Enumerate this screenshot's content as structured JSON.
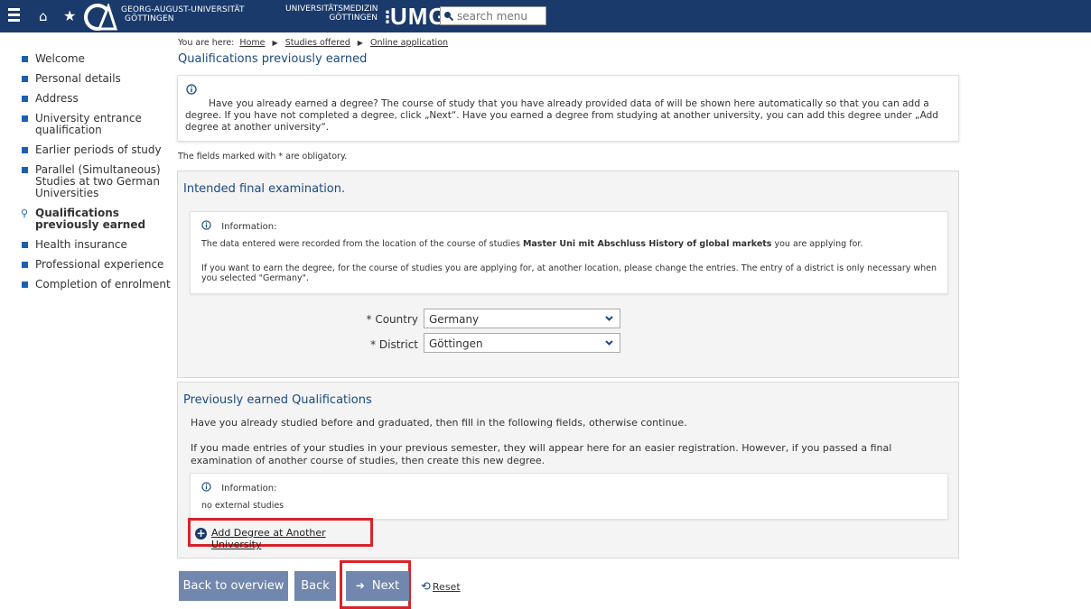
{
  "header": {
    "university_line1": "GEORG-AUGUST-UNIVERSITÄT",
    "university_line2": "GÖTTINGEN",
    "umg_line1": "UNIVERSITÄTSMEDIZIN",
    "umg_line2": "GÖTTINGEN",
    "umg_logo": "UMG",
    "search_placeholder": "search menu",
    "icons": [
      "menu-icon",
      "home-icon",
      "star-icon",
      "search-icon"
    ]
  },
  "breadcrumb": {
    "prefix": "You are here:",
    "items": [
      "Home",
      "Studies offered",
      "Online application"
    ]
  },
  "page_title": "Qualifications previously earned",
  "sidebar": {
    "items": [
      {
        "label": "Welcome"
      },
      {
        "label": "Personal details"
      },
      {
        "label": "Address"
      },
      {
        "label": "University entrance qualification"
      },
      {
        "label": "Earlier periods of study"
      },
      {
        "label": "Parallel (Simultaneous) Studies at two German Universities"
      },
      {
        "label": "Qualifications previously earned"
      },
      {
        "label": "Health insurance"
      },
      {
        "label": "Professional experience"
      },
      {
        "label": "Completion of enrolment"
      }
    ]
  },
  "intro": {
    "text": "Have you already earned a degree? The course of study that you have already provided data of will be shown here automatically so that you can add a degree. If you have not completed a degree, click „Next“. Have you earned a degree from studying at another university, you can add this degree under „Add degree at another university“."
  },
  "obligatory_note": "The fields marked with * are obligatory.",
  "section1": {
    "title": "Intended final examination.",
    "info_label": "Information:",
    "info_line1_pre": "The data entered were recorded from the location of the course of studies",
    "info_line1_bold": "Master Uni mit Abschluss History of global markets",
    "info_line1_post": "you are applying for.",
    "info_line2": "If you want to earn the degree, for the course of studies you are applying for, at another location, please change the entries. The entry of a district is only necessary when you selected \"Germany\".",
    "country_label": "* Country",
    "country_value": "Germany",
    "district_label": "* District",
    "district_value": "Göttingen"
  },
  "section2": {
    "title": "Previously earned Qualifications",
    "text1": "Have you already studied before and graduated, then fill in the following fields, otherwise continue.",
    "text2": "If you made entries of your studies in your previous semester, they will appear here for an easier registration. However, if you passed a final examination of another course of studies, then create this new degree.",
    "info_label": "Information:",
    "info_text": "no external studies",
    "add_link": "Add Degree at Another University"
  },
  "buttons": {
    "overview": "Back to overview",
    "back": "Back",
    "next": "Next",
    "reset": "Reset"
  },
  "colors": {
    "header_bg": "#1a3a6c",
    "button_bg": "#7287ad",
    "highlight": "#d8232a",
    "link_blue": "#1a4a80"
  }
}
